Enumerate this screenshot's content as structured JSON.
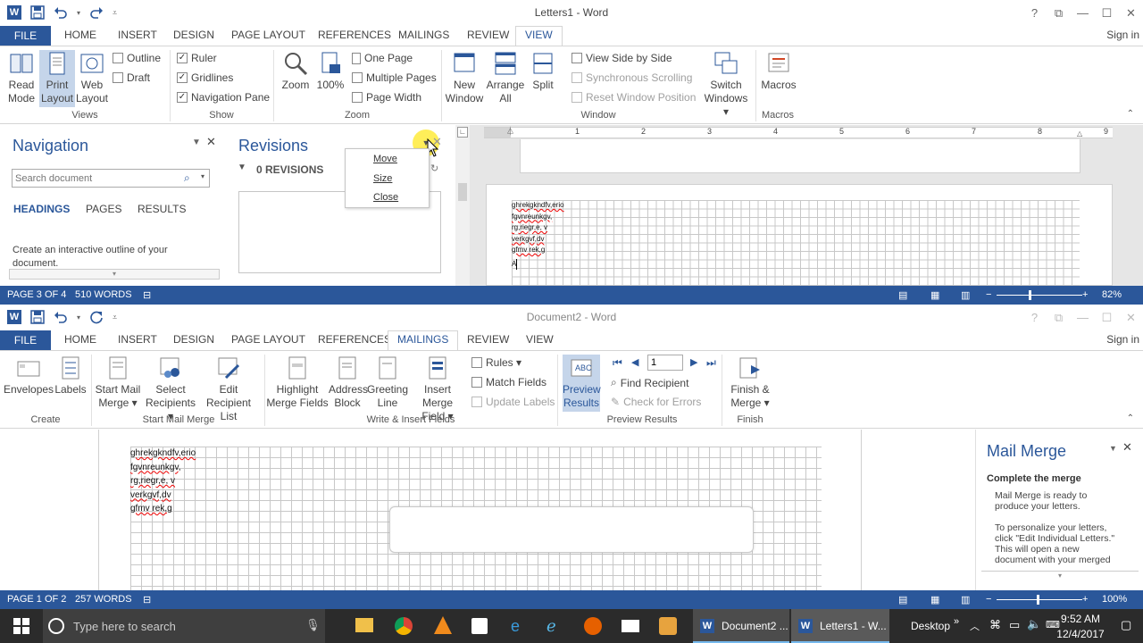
{
  "window1": {
    "title": "Letters1 - Word",
    "tabs": {
      "file": "FILE",
      "home": "HOME",
      "insert": "INSERT",
      "design": "DESIGN",
      "page_layout": "PAGE LAYOUT",
      "references": "REFERENCES",
      "mailings": "MAILINGS",
      "review": "REVIEW",
      "view": "VIEW"
    },
    "sign_in": "Sign in",
    "ribbon": {
      "read_mode": [
        "Read",
        "Mode"
      ],
      "print_layout": [
        "Print",
        "Layout"
      ],
      "web_layout": [
        "Web",
        "Layout"
      ],
      "outline": "Outline",
      "draft": "Draft",
      "views_label": "Views",
      "ruler": "Ruler",
      "gridlines": "Gridlines",
      "navigation_pane": "Navigation Pane",
      "show_label": "Show",
      "zoom": "Zoom",
      "zoom_100": "100%",
      "one_page": "One Page",
      "multiple_pages": "Multiple Pages",
      "page_width": "Page Width",
      "zoom_label": "Zoom",
      "new_window": [
        "New",
        "Window"
      ],
      "arrange_all": [
        "Arrange",
        "All"
      ],
      "split": "Split",
      "view_side_by_side": "View Side by Side",
      "synchronous_scrolling": "Synchronous Scrolling",
      "reset_window_position": "Reset Window Position",
      "switch_windows": [
        "Switch",
        "Windows ▾"
      ],
      "window_label": "Window",
      "macros": "Macros",
      "macros_label": "Macros"
    },
    "navigation": {
      "title": "Navigation",
      "search_placeholder": "Search document",
      "tabs": [
        "HEADINGS",
        "PAGES",
        "RESULTS"
      ],
      "hint": "Create an interactive outline of your document."
    },
    "revisions": {
      "title": "Revisions",
      "count": "0 REVISIONS"
    },
    "context_menu": [
      "Move",
      "Size",
      "Close"
    ],
    "doc_lines": [
      "ghrekgkndfv,erio",
      "fgvnreunkgv,",
      "rg,riegr,e, v",
      " verkgvf,dv",
      "gfmv rek,g",
      "A"
    ],
    "ruler_numbers": [
      "1",
      "2",
      "3",
      "4",
      "5",
      "6",
      "7",
      "8",
      "9"
    ],
    "status": {
      "page": "PAGE 3 OF 4",
      "words": "510 WORDS",
      "zoom": "82%"
    }
  },
  "window2": {
    "title": "Document2 - Word",
    "tabs": {
      "file": "FILE",
      "home": "HOME",
      "insert": "INSERT",
      "design": "DESIGN",
      "page_layout": "PAGE LAYOUT",
      "references": "REFERENCES",
      "mailings": "MAILINGS",
      "review": "REVIEW",
      "view": "VIEW"
    },
    "sign_in": "Sign in",
    "ribbon": {
      "envelopes": "Envelopes",
      "labels": "Labels",
      "create_label": "Create",
      "start_mail_merge": [
        "Start Mail",
        "Merge ▾"
      ],
      "select_recipients": [
        "Select",
        "Recipients ▾"
      ],
      "edit_recipient_list": [
        "Edit",
        "Recipient List"
      ],
      "start_mail_merge_label": "Start Mail Merge",
      "highlight_merge_fields": [
        "Highlight",
        "Merge Fields"
      ],
      "address_block": [
        "Address",
        "Block"
      ],
      "greeting_line": [
        "Greeting",
        "Line"
      ],
      "insert_merge_field": [
        "Insert Merge",
        "Field ▾"
      ],
      "rules": "Rules ▾",
      "match_fields": "Match Fields",
      "update_labels": "Update Labels",
      "write_insert_label": "Write & Insert Fields",
      "preview_results": [
        "Preview",
        "Results"
      ],
      "record_value": "1",
      "find_recipient": "Find Recipient",
      "check_for_errors": "Check for Errors",
      "preview_results_label": "Preview Results",
      "finish_merge": [
        "Finish &",
        "Merge ▾"
      ],
      "finish_label": "Finish"
    },
    "doc_lines": [
      "ghrekgkndfv,erio",
      "fgvnreunkgv,",
      "rg,riegr,e, v",
      " verkgvf,dv",
      "gfmv rek,g"
    ],
    "mail_merge": {
      "title": "Mail Merge",
      "heading": "Complete the merge",
      "para1": "Mail Merge is ready to produce your letters.",
      "para2": "To personalize your letters, click \"Edit Individual Letters.\" This will open a new document with your merged letters. To make changes to"
    },
    "status": {
      "page": "PAGE 1 OF 2",
      "words": "257 WORDS",
      "zoom": "100%"
    }
  },
  "taskbar": {
    "search_placeholder": "Type here to search",
    "apps": [
      "Document2 ...",
      "Letters1 - W..."
    ],
    "desktop": "Desktop",
    "time": "9:52 AM",
    "date": "12/4/2017"
  }
}
